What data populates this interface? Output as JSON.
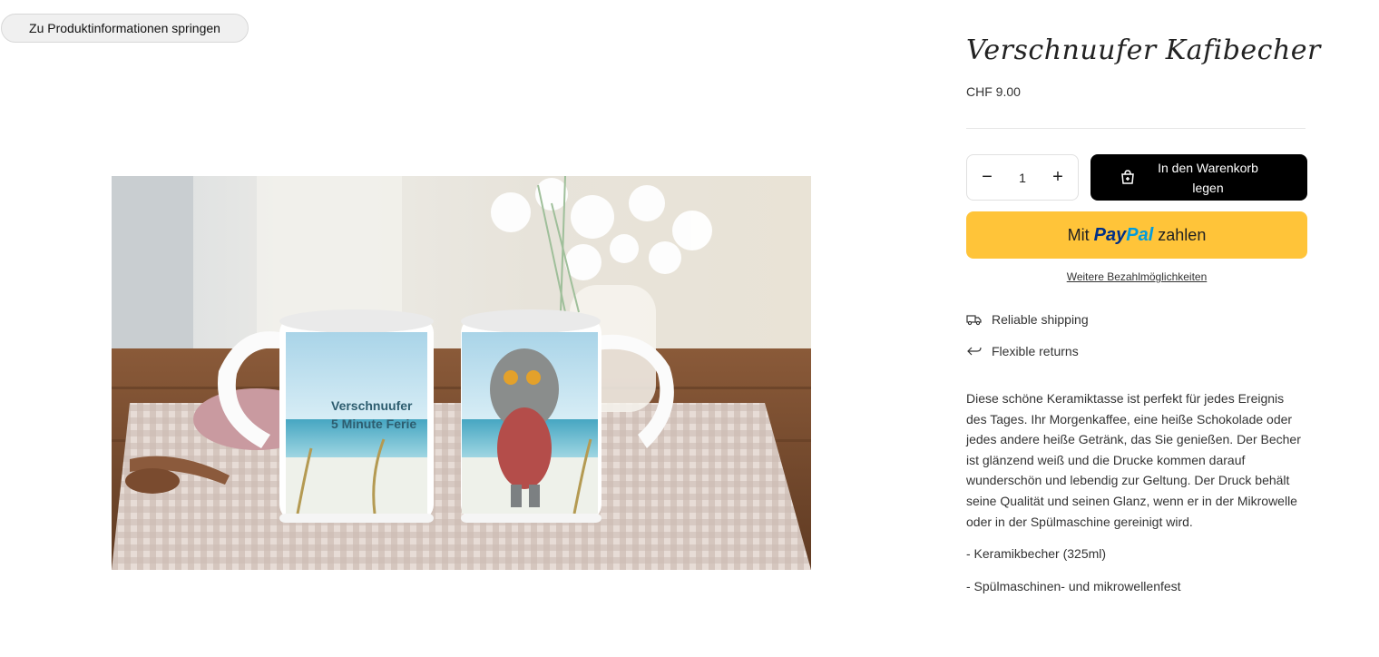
{
  "skip_link": "Zu Produktinformationen springen",
  "product": {
    "title": "Verschnuufer Kafibecher",
    "price": "CHF 9.00",
    "image": {
      "mug_left_text_line1": "Verschnuufer",
      "mug_left_text_line2": "5 Minute Ferie"
    }
  },
  "quantity": {
    "decrease": "−",
    "value": "1",
    "increase": "+"
  },
  "buttons": {
    "add_to_cart": "In den Warenkorb legen",
    "paypal_prefix": "Mit",
    "paypal_brand_1": "Pay",
    "paypal_brand_2": "Pal",
    "paypal_suffix": "zahlen",
    "more_payment_options": "Weitere Bezahlmöglichkeiten"
  },
  "features": [
    {
      "icon": "truck-icon",
      "label": "Reliable shipping"
    },
    {
      "icon": "return-arrow-icon",
      "label": "Flexible returns"
    }
  ],
  "description": [
    "Diese schöne Keramiktasse ist perfekt für jedes Ereignis des Tages. Ihr Morgenkaffee, eine heiße Schokolade oder jedes andere heiße Getränk, das Sie genießen. Der Becher ist glänzend weiß und die Drucke kommen darauf wunderschön und lebendig zur Geltung. Der Druck behält seine Qualität und seinen Glanz, wenn er in der Mikrowelle oder in der Spülmaschine gereinigt wird.",
    "- Keramikbecher (325ml)",
    "- Spülmaschinen- und mikrowellenfest"
  ],
  "colors": {
    "paypal_yellow": "#ffc439",
    "paypal_dark_blue": "#003087",
    "paypal_light_blue": "#009cde",
    "cart_button": "#000000"
  }
}
